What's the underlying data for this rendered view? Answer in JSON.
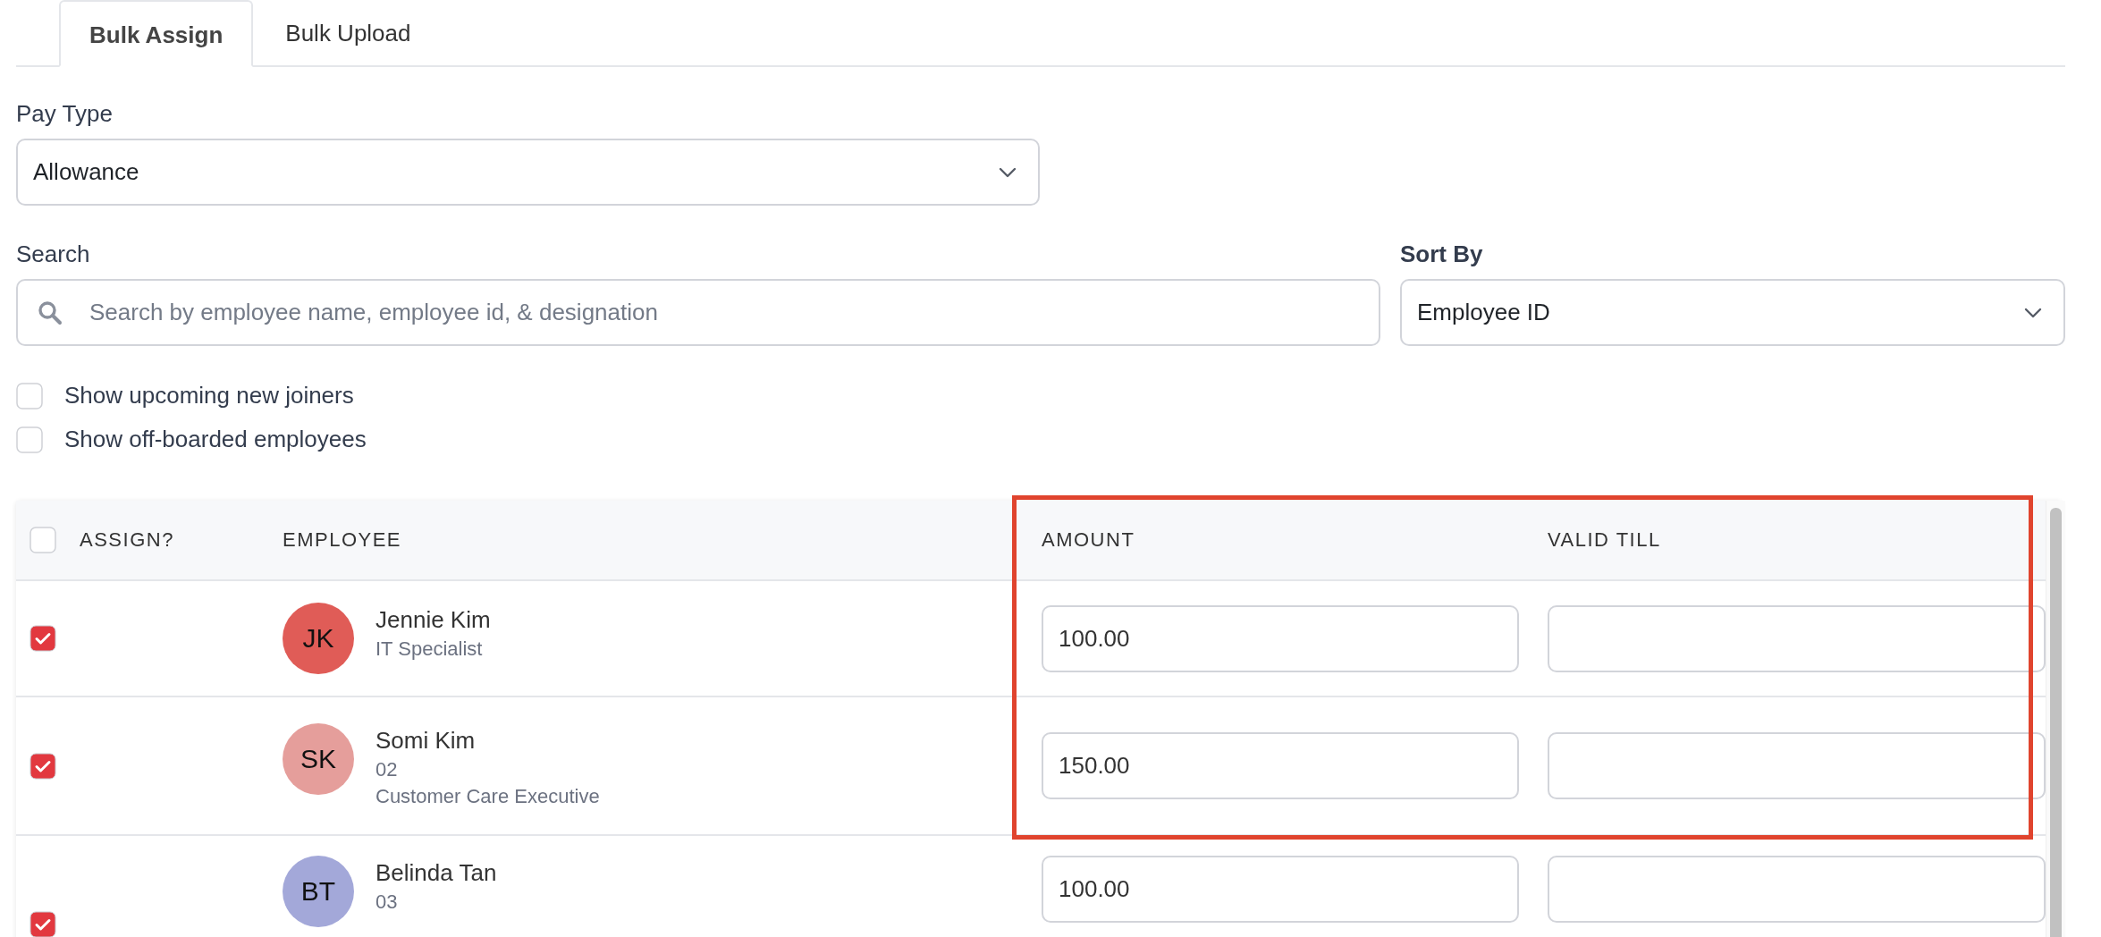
{
  "tabs": [
    {
      "label": "Bulk Assign",
      "selected": true
    },
    {
      "label": "Bulk Upload",
      "selected": false
    }
  ],
  "pay_type": {
    "label": "Pay Type",
    "value": "Allowance"
  },
  "search": {
    "label": "Search",
    "placeholder": "Search by employee name, employee id, & designation"
  },
  "sort_by": {
    "label": "Sort By",
    "value": "Employee ID"
  },
  "filters": [
    {
      "label": "Show upcoming new joiners",
      "checked": false
    },
    {
      "label": "Show off-boarded employees",
      "checked": false
    }
  ],
  "table": {
    "select_all": {
      "checked": false
    },
    "columns": [
      "ASSIGN?",
      "EMPLOYEE",
      "AMOUNT",
      "VALID TILL"
    ],
    "rows": [
      {
        "checked": true,
        "initials": "JK",
        "color": "#e05c57",
        "name": "Jennie Kim",
        "details": [
          "IT Specialist"
        ],
        "amount": "100.00"
      },
      {
        "checked": true,
        "initials": "SK",
        "color": "#e59e9b",
        "name": "Somi Kim",
        "details": [
          "02",
          "Customer Care Executive"
        ],
        "amount": "150.00"
      },
      {
        "checked": true,
        "initials": "BT",
        "color": "#a3a8d9",
        "name": "Belinda Tan",
        "details": [
          "03"
        ],
        "amount": "100.00"
      }
    ]
  },
  "highlight_box": true
}
